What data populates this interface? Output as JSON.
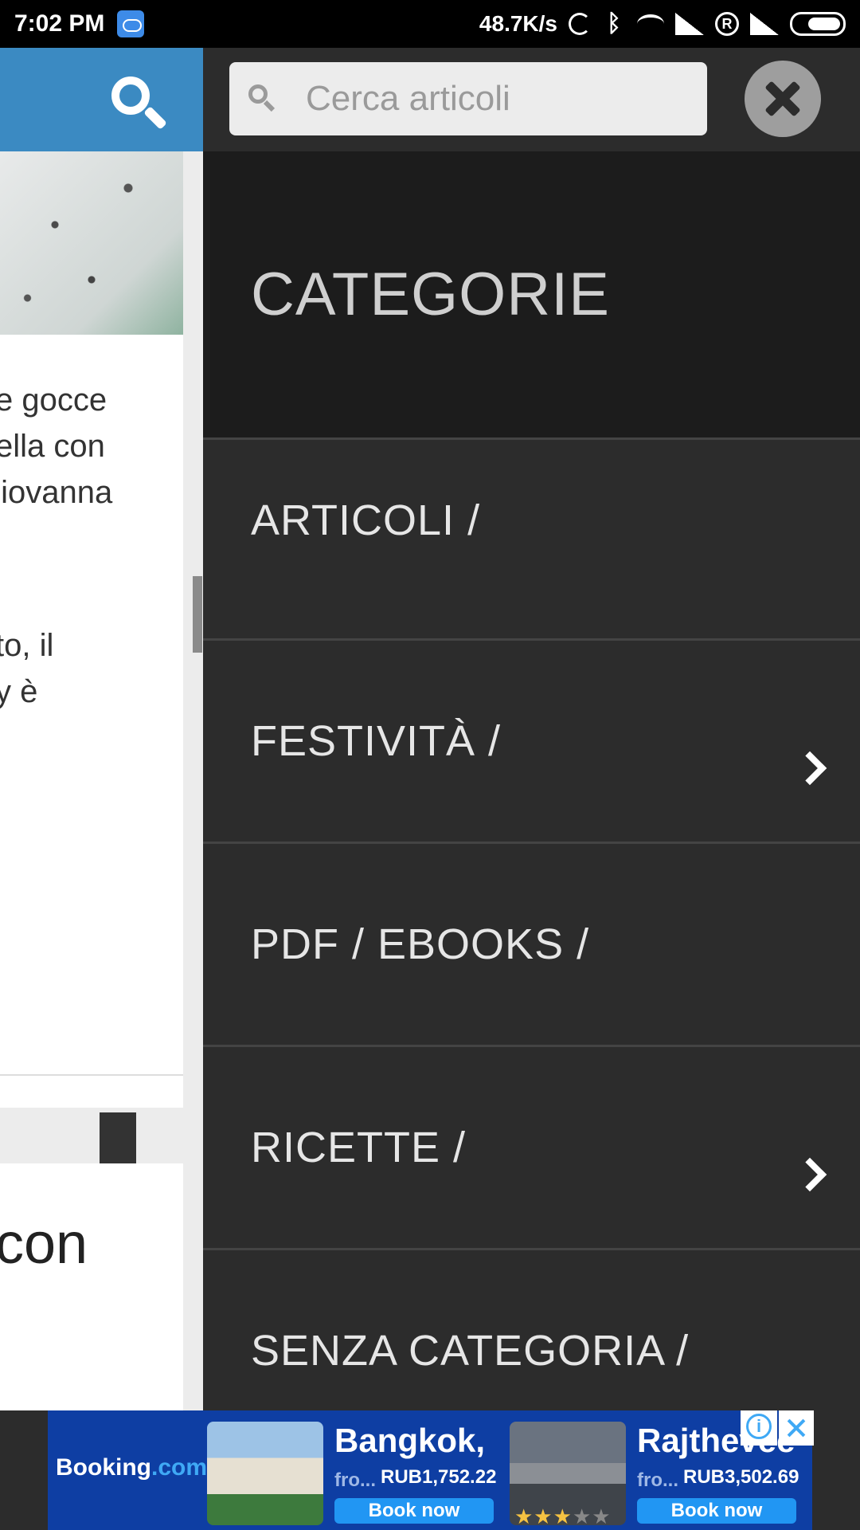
{
  "status_bar": {
    "time": "7:02 PM",
    "net_speed": "48.7K/s",
    "roaming": "R"
  },
  "background_page": {
    "text_lines": [
      "e gocce",
      "ella con",
      "Giovanna",
      "to, il",
      "y è"
    ],
    "card2_text": "con"
  },
  "drawer": {
    "search": {
      "placeholder": "Cerca articoli",
      "value": ""
    },
    "heading": "CATEGORIE",
    "items": [
      {
        "label": "ARTICOLI /",
        "has_children": false
      },
      {
        "label": "FESTIVITÀ /",
        "has_children": true
      },
      {
        "label": "PDF / EBOOKS /",
        "has_children": false
      },
      {
        "label": "RICETTE /",
        "has_children": true
      },
      {
        "label": "SENZA CATEGORIA /",
        "has_children": false
      }
    ]
  },
  "ad": {
    "brand": "Booking",
    "brand_suffix": ".com",
    "offers": [
      {
        "city": "Bangkok,",
        "from": "fro...",
        "price": "RUB1,752.22",
        "cta": "Book now"
      },
      {
        "city": "Rajthevee",
        "from": "fro...",
        "price": "RUB3,502.69",
        "cta": "Book now",
        "stars": 3,
        "max_stars": 5
      }
    ]
  },
  "colors": {
    "drawer_bg": "#2c2c2c",
    "heading_bg": "#1c1c1c",
    "header_blue": "#3b8ac2",
    "ad_blue": "#0e3ea3"
  }
}
